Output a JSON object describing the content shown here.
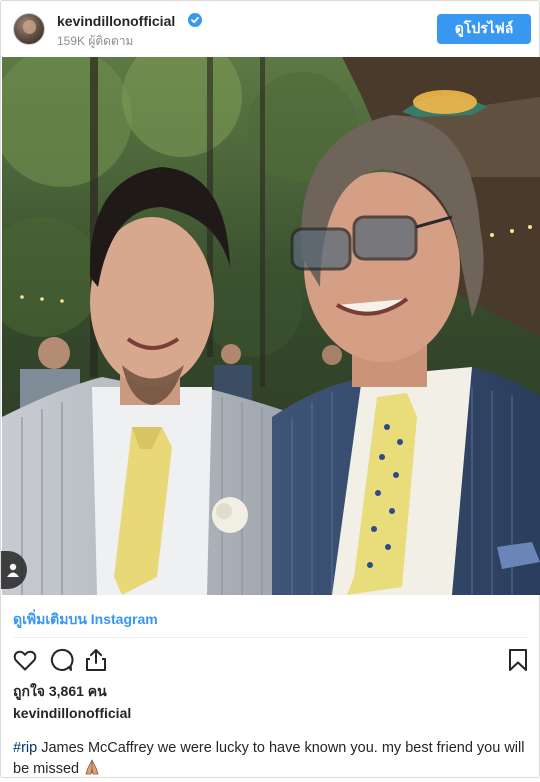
{
  "header": {
    "username": "kevindillonofficial",
    "followers": "159K ผู้ติดตาม",
    "profile_button": "ดูโปรไฟล์"
  },
  "post": {
    "view_more": "ดูเพิ่มเติมบน Instagram",
    "likes": "ถูกใจ 3,861 คน",
    "owner": "kevindillonofficial",
    "caption_hashtag": "#rip",
    "caption_text": " James McCaffrey we were lucky to have known you. my best friend you will be missed ",
    "caption_emoji": "pray-hands-emoji"
  },
  "icons": {
    "verified": "verified-badge-icon",
    "like": "heart-icon",
    "comment": "comment-bubble-icon",
    "share": "share-icon",
    "save": "bookmark-icon",
    "tag": "user-tag-icon"
  },
  "colors": {
    "accent": "#3897f0",
    "text": "#262626",
    "muted": "#8e8e8e",
    "hashtag": "#003569"
  }
}
